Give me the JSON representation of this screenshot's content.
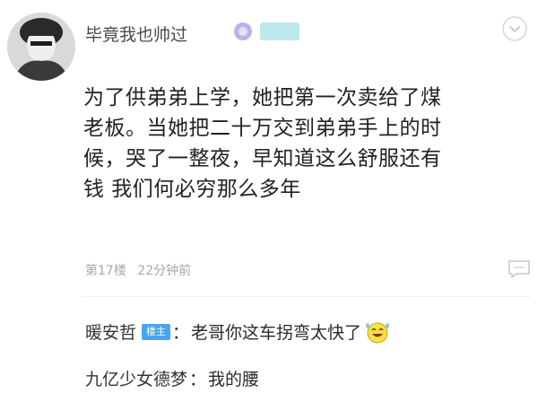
{
  "post": {
    "username": "毕竟我也帅过",
    "tag_badge": "",
    "body_lines": [
      "为了供弟弟上学，她把第一次卖给了煤",
      "老板。当她把二十万交到弟弟手上的时",
      "候，哭了一整夜，早知道这么舒服还有",
      "钱 我们何必穷那么多年"
    ],
    "floor": "第17楼",
    "time": "22分钟前"
  },
  "replies": [
    {
      "name": "暖安哲",
      "badge": "楼主",
      "colon": "：",
      "text": "老哥你这车拐弯太快了",
      "emoji": "laughing-emoji-icon"
    },
    {
      "name": "九亿少女德梦",
      "colon": "：",
      "text": "我的腰"
    }
  ],
  "colors": {
    "host_badge": "#4aa3f0",
    "tag_badge": "#bfe8ec",
    "meta_text": "#a8a8a8",
    "level_icon": "#b9b3ea"
  }
}
